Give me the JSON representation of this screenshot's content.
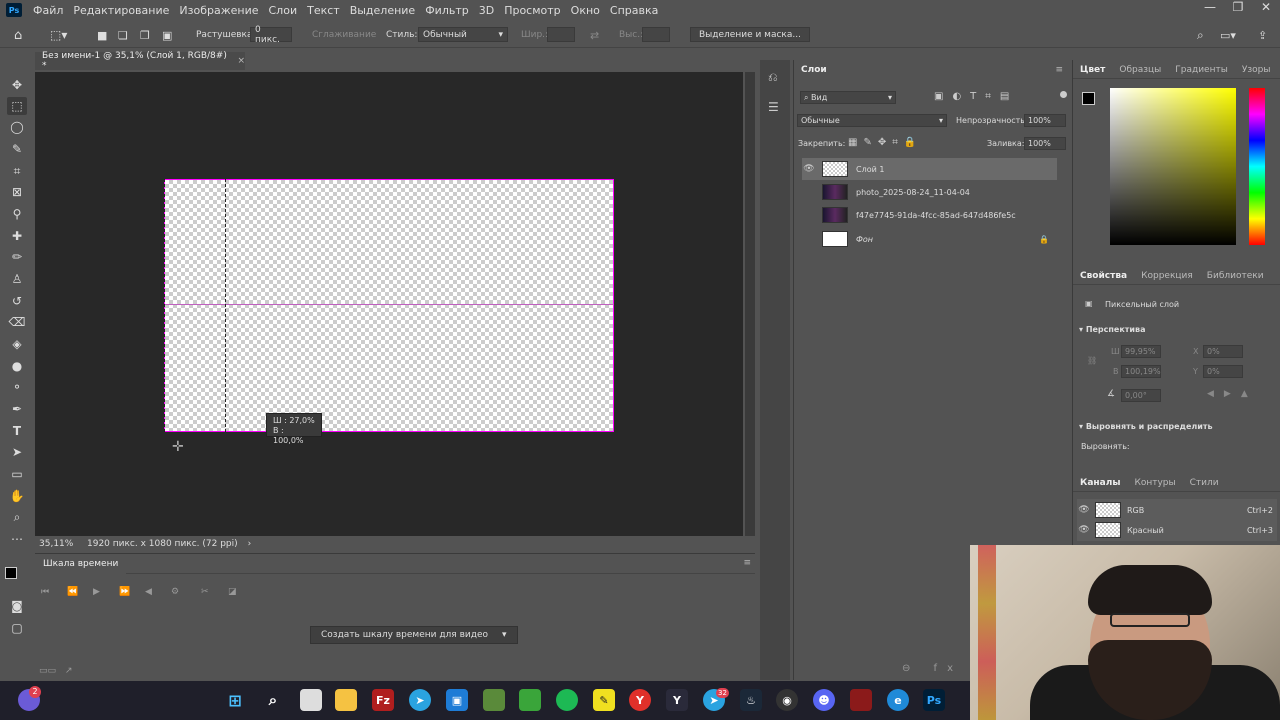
{
  "menu": [
    "Файл",
    "Редактирование",
    "Изображение",
    "Слои",
    "Текст",
    "Выделение",
    "Фильтр",
    "3D",
    "Просмотр",
    "Окно",
    "Справка"
  ],
  "app_logo": "Ps",
  "window_controls": [
    "—",
    "❐",
    "✕"
  ],
  "options": {
    "feather_label": "Растушевка:",
    "feather_value": "0 пикс.",
    "antialias": "Сглаживание",
    "style_label": "Стиль:",
    "style_value": "Обычный",
    "width_label": "Шир.:",
    "height_label": "Выс.:",
    "select_mask": "Выделение и маска..."
  },
  "document": {
    "tab": "Без имени-1 @ 35,1% (Слой 1, RGB/8#) *",
    "close": "×",
    "zoom": "35,11%",
    "info": "1920 пикс. x 1080 пикс. (72 ppi)"
  },
  "tooltip": {
    "w": "Ш :  27,0%",
    "h": "В : 100,0%"
  },
  "timeline": {
    "tab": "Шкала времени",
    "create_button": "Создать шкалу времени для видео"
  },
  "layers_panel": {
    "title": "Слои",
    "filter": "Вид",
    "blend": "Обычные",
    "opacity_label": "Непрозрачность:",
    "opacity_value": "100%",
    "lock_label": "Закрепить:",
    "fill_label": "Заливка:",
    "fill_value": "100%",
    "layers": [
      {
        "name": "Слой 1"
      },
      {
        "name": "photo_2025-08-24_11-04-04"
      },
      {
        "name": "f47e7745-91da-4fcc-85ad-647d486fe5c"
      },
      {
        "name": "Фон"
      }
    ]
  },
  "color_panel": {
    "tabs": [
      "Цвет",
      "Образцы",
      "Градиенты",
      "Узоры"
    ]
  },
  "properties_panel": {
    "tabs": [
      "Свойства",
      "Коррекция",
      "Библиотеки"
    ],
    "type": "Пиксельный слой",
    "perspective": "Перспектива",
    "w_label": "Ш",
    "w_value": "99,95%",
    "h_label": "В",
    "h_value": "100,19%",
    "x_label": "X",
    "x_value": "0%",
    "y_label": "Y",
    "y_value": "0%",
    "angle_value": "0,00°",
    "align_section": "Выровнять и распределить",
    "align_label": "Выровнять:"
  },
  "channels_panel": {
    "tabs": [
      "Каналы",
      "Контуры",
      "Стили"
    ],
    "channels": [
      {
        "name": "RGB",
        "shortcut": "Ctrl+2"
      },
      {
        "name": "Красный",
        "shortcut": "Ctrl+3"
      }
    ]
  },
  "taskbar": {
    "notification_badge": "2",
    "telegram_badge": "32"
  }
}
